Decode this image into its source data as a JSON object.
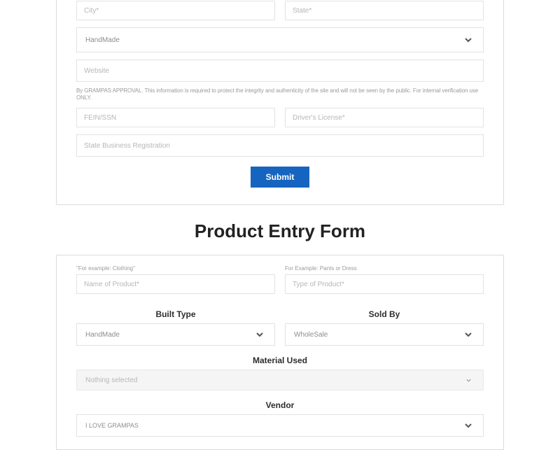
{
  "vendor_form": {
    "city_ph": "City*",
    "state_ph": "State*",
    "select_handmade": "HandMade",
    "website_ph": "Website",
    "approval_note": "By GRAMPAS APPROVAL. This information is required to protect the integrity and authenticity of the site and will not be seen by the public. For internal verification use ONLY.",
    "fein_ph": "FEIN/SSN",
    "drivers_ph": "Driver's License*",
    "state_reg_ph": "State Business Registration",
    "submit_label": "Submit"
  },
  "product_form": {
    "title": "Product Entry Form",
    "name_hint": "\"For example: Clothing\"",
    "type_hint": "For Example: Pants or Dress",
    "name_ph": "Name of Product*",
    "type_ph": "Type of Product*",
    "built_type_label": "Built Type",
    "sold_by_label": "Sold By",
    "built_type_value": "HandMade",
    "sold_by_value": "WholeSale",
    "material_label": "Material Used",
    "material_value": "Nothing selected",
    "vendor_label": "Vendor",
    "vendor_value": "I LOVE GRAMPAS"
  }
}
